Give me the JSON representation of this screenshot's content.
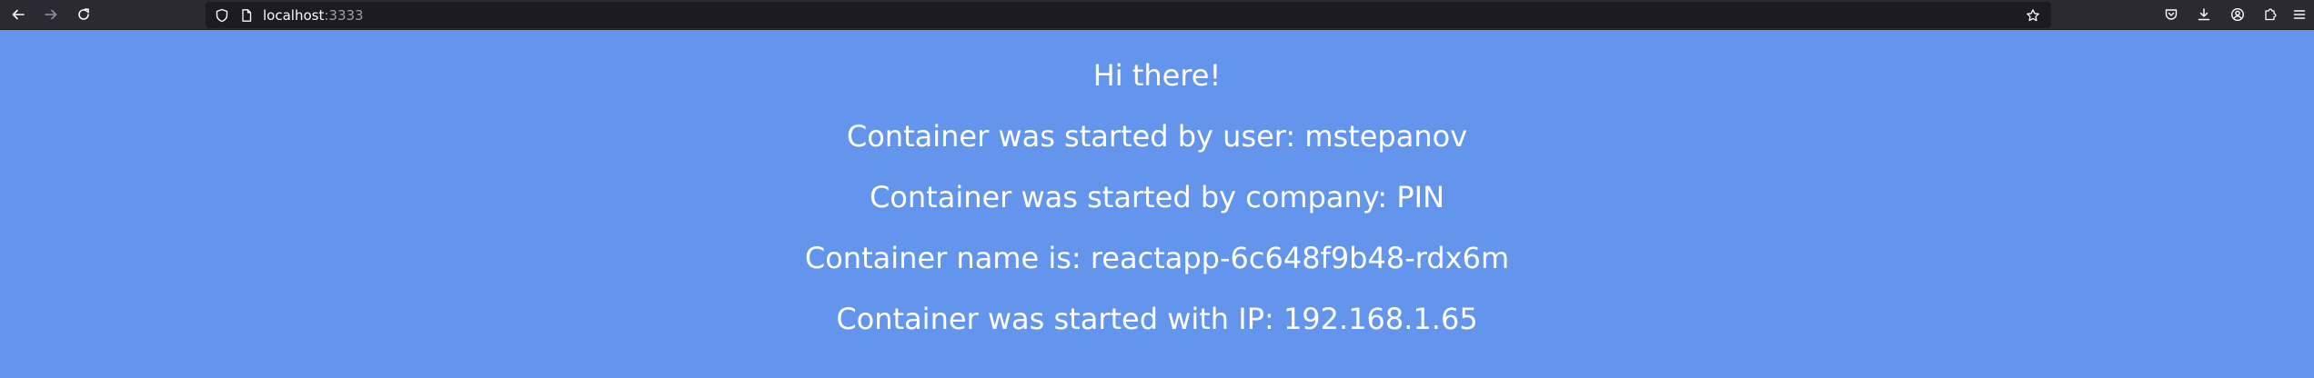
{
  "browser": {
    "url_host": "localhost",
    "url_port": ":3333",
    "icons": {
      "back": "arrow-left-icon",
      "forward": "arrow-right-icon",
      "reload": "reload-icon",
      "tracking": "shield-icon",
      "page_info": "page-icon",
      "bookmark": "star-icon",
      "pocket": "pocket-icon",
      "downloads": "download-icon",
      "account": "account-icon",
      "extensions": "puzzle-icon",
      "menu": "hamburger-menu-icon"
    }
  },
  "page": {
    "background": "#6495ed",
    "greeting": "Hi there!",
    "started_by_user": "Container was started by user: mstepanov",
    "started_by_company": "Container was started by company: PIN",
    "container_name": "Container name is: reactapp-6c648f9b48-rdx6m",
    "started_with_ip": "Container was started with IP: 192.168.1.65"
  }
}
